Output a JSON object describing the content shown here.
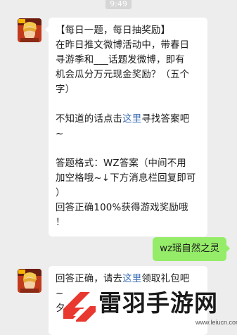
{
  "chat": {
    "timestamp": "9:49",
    "message1": {
      "line1": "【每日一题，每日抽奖励】",
      "line2": "在昨日推文微博活动中，带春日",
      "line3": "寻游季和___话题发微博，即有",
      "line4": "机会瓜分万元现金奖励？（五个",
      "line5": "字）",
      "hint_prefix": "不知道的话点击",
      "hint_link": "这里",
      "hint_suffix": "寻找答案吧",
      "hint_tail": "~",
      "format_line1": "答题格式：WZ答案（中间不用",
      "format_line2": "加空格哦~↓下方消息栏回复即可",
      "format_line3": "）",
      "reward_line1": "回答正确100%获得游戏奖励哦",
      "reward_line2": "！"
    },
    "reply": {
      "text": "wz瑶自然之灵"
    },
    "message2": {
      "prefix": "回答正确，请去",
      "link": "这里",
      "suffix": "领取礼包吧",
      "line2": "~",
      "line3": "夕"
    }
  },
  "watermark": {
    "text": "雷羽手游网",
    "url": "www.leiucn.com"
  },
  "colors": {
    "background": "#ededed",
    "bubble": "#ffffff",
    "reply_bubble": "#95ec69",
    "link": "#3d6fb6",
    "logo_red": "#e8382f"
  }
}
